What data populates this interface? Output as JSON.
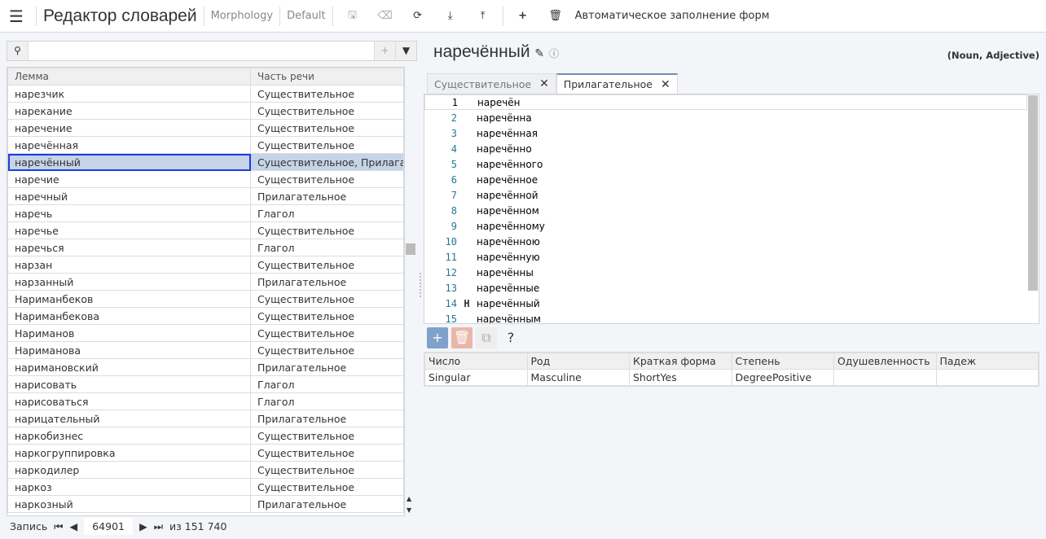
{
  "app": {
    "title": "Редактор словарей",
    "crumbs": [
      "Morphology",
      "Default"
    ],
    "auto_fill": "Автоматическое заполнение форм"
  },
  "search": {
    "value": "",
    "placeholder": ""
  },
  "lemma_table": {
    "columns": [
      "Лемма",
      "Часть речи"
    ],
    "selected_index": 4,
    "rows": [
      [
        "нарезчик",
        "Существительное"
      ],
      [
        "нарекание",
        "Существительное"
      ],
      [
        "наречение",
        "Существительное"
      ],
      [
        "наречённая",
        "Существительное"
      ],
      [
        "наречённый",
        "Существительное, Прилагательное"
      ],
      [
        "наречие",
        "Существительное"
      ],
      [
        "наречный",
        "Прилагательное"
      ],
      [
        "наречь",
        "Глагол"
      ],
      [
        "наречье",
        "Существительное"
      ],
      [
        "наречься",
        "Глагол"
      ],
      [
        "нарзан",
        "Существительное"
      ],
      [
        "нарзанный",
        "Прилагательное"
      ],
      [
        "Нариманбеков",
        "Существительное"
      ],
      [
        "Нариманбекова",
        "Существительное"
      ],
      [
        "Нариманов",
        "Существительное"
      ],
      [
        "Нариманова",
        "Существительное"
      ],
      [
        "наримановский",
        "Прилагательное"
      ],
      [
        "нарисовать",
        "Глагол"
      ],
      [
        "нарисоваться",
        "Глагол"
      ],
      [
        "нарицательный",
        "Прилагательное"
      ],
      [
        "наркобизнес",
        "Существительное"
      ],
      [
        "наркогруппировка",
        "Существительное"
      ],
      [
        "наркодилер",
        "Существительное"
      ],
      [
        "наркоз",
        "Существительное"
      ],
      [
        "наркозный",
        "Прилагательное"
      ]
    ]
  },
  "pager": {
    "label": "Запись",
    "current": "64901",
    "total": "из 151 740"
  },
  "lemma": {
    "title": "наречённый",
    "pos": "(Noun, Adjective)"
  },
  "tabs": [
    {
      "label": "Существительное",
      "active": false
    },
    {
      "label": "Прилагательное",
      "active": true
    }
  ],
  "forms": [
    {
      "n": "1",
      "m": "",
      "t": "наречён"
    },
    {
      "n": "2",
      "m": "",
      "t": "наречённа"
    },
    {
      "n": "3",
      "m": "",
      "t": "наречённая"
    },
    {
      "n": "4",
      "m": "",
      "t": "наречённо"
    },
    {
      "n": "5",
      "m": "",
      "t": "наречённого"
    },
    {
      "n": "6",
      "m": "",
      "t": "наречённое"
    },
    {
      "n": "7",
      "m": "",
      "t": "наречённой"
    },
    {
      "n": "8",
      "m": "",
      "t": "наречённом"
    },
    {
      "n": "9",
      "m": "",
      "t": "наречённому"
    },
    {
      "n": "10",
      "m": "",
      "t": "наречённою"
    },
    {
      "n": "11",
      "m": "",
      "t": "наречённую"
    },
    {
      "n": "12",
      "m": "",
      "t": "наречённы"
    },
    {
      "n": "13",
      "m": "",
      "t": "наречённые"
    },
    {
      "n": "14",
      "m": "Н",
      "t": "наречённый"
    },
    {
      "n": "15",
      "m": "",
      "t": "наречённым"
    }
  ],
  "form_buttons": {
    "help": "?"
  },
  "grammemes": {
    "columns": [
      "Число",
      "Род",
      "Краткая форма",
      "Степень",
      "Одушевленность",
      "Падеж"
    ],
    "row": [
      "Singular",
      "Masculine",
      "ShortYes",
      "DegreePositive",
      "",
      ""
    ]
  },
  "colors": {
    "accent": "#6e8fb8",
    "selected_row": "#c5d4e6",
    "selected_border": "#1a3ee0",
    "add_btn": "#7ea2c9",
    "delete_btn": "#e8b7a8"
  }
}
